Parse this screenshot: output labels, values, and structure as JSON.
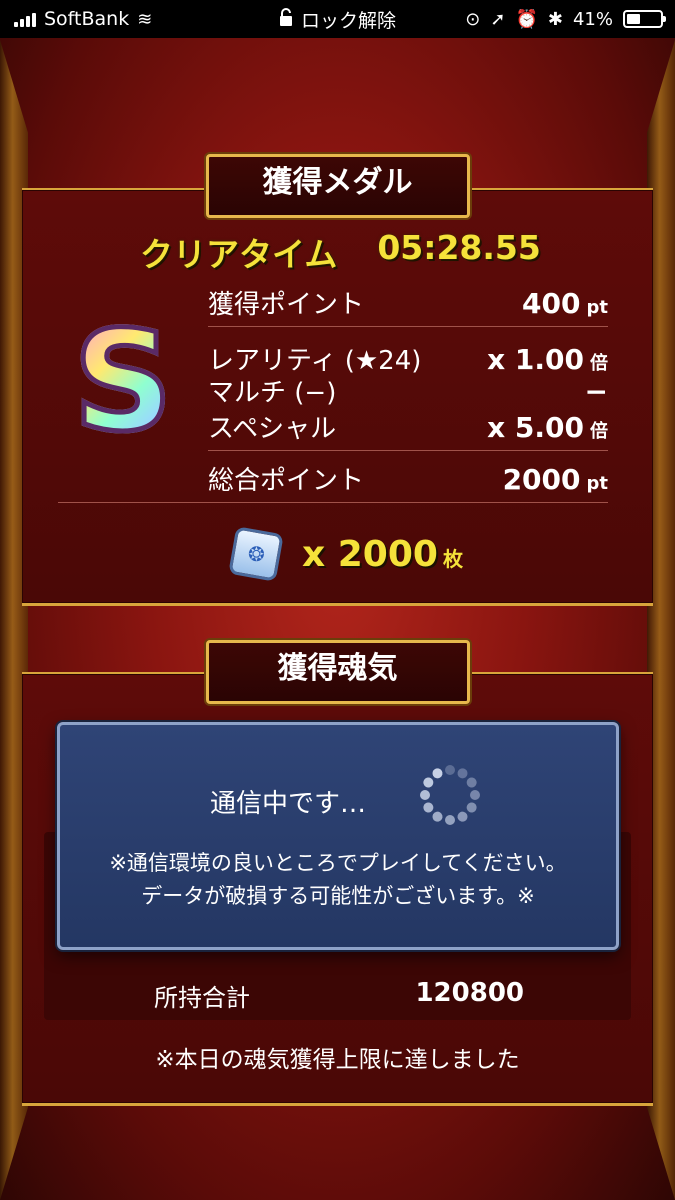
{
  "status_bar": {
    "carrier": "SoftBank",
    "center_text": "ロック解除",
    "battery": "41%",
    "battery_level": 0.41
  },
  "medal_panel": {
    "title": "獲得メダル",
    "clear_time_label": "クリアタイム",
    "clear_time_value": "05:28.55",
    "rank": "S",
    "rows": [
      {
        "label": "獲得ポイント",
        "value": "400",
        "unit": "pt"
      },
      {
        "label": "レアリティ (★24)",
        "value": "x 1.00",
        "unit": "倍"
      },
      {
        "label": "マルチ (−)",
        "value": "−",
        "unit": ""
      },
      {
        "label": "スペシャル",
        "value": "x 5.00",
        "unit": "倍"
      },
      {
        "label": "総合ポイント",
        "value": "2000",
        "unit": "pt"
      }
    ],
    "medals_value": "x 2000",
    "medals_unit": "枚"
  },
  "soul_panel": {
    "title": "獲得魂気",
    "owned_label": "所持合計",
    "owned_value": "120800",
    "limit_message": "※本日の魂気獲得上限に達しました"
  },
  "dialog": {
    "message": "通信中です…",
    "note_line1": "※通信環境の良いところでプレイしてください。",
    "note_line2": "データが破損する可能性がございます。※"
  }
}
